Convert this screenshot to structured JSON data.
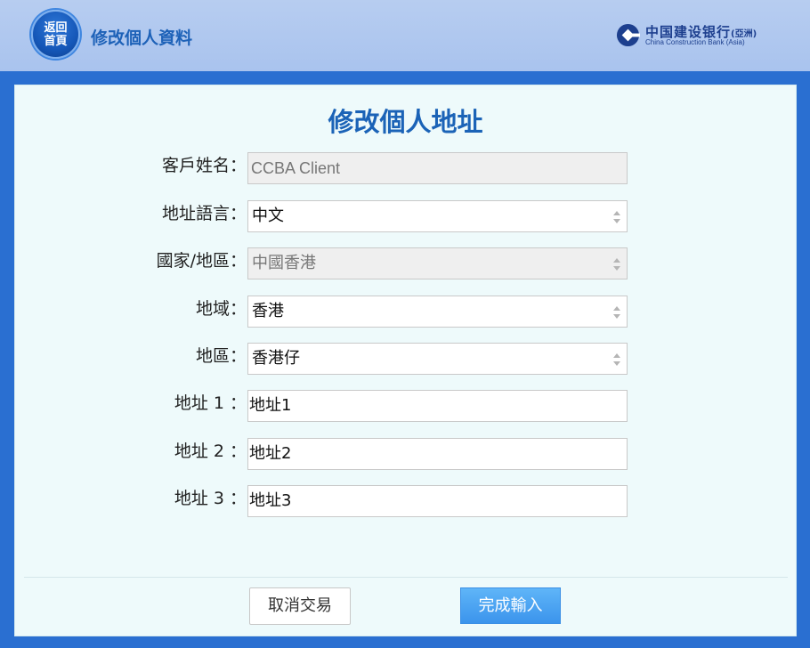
{
  "header": {
    "home_label": "返回首頁",
    "title": "修改個人資料",
    "logo_cn": "中国建设银行",
    "logo_cn_suffix": "(亞洲)",
    "logo_en": "China Construction Bank (Asia)"
  },
  "form": {
    "title": "修改個人地址",
    "fields": [
      {
        "label": "客戶姓名：",
        "value": "CCBA Client",
        "type": "readonly"
      },
      {
        "label": "地址語言：",
        "value": "中文",
        "type": "select"
      },
      {
        "label": "國家/地區：",
        "value": "中國香港",
        "type": "select-disabled"
      },
      {
        "label": "地域：",
        "value": "香港",
        "type": "select"
      },
      {
        "label": "地區：",
        "value": "香港仔",
        "type": "select"
      },
      {
        "label": "地址 1 ：",
        "value": "地址1",
        "type": "input"
      },
      {
        "label": "地址 2 ：",
        "value": "地址2",
        "type": "input"
      },
      {
        "label": "地址 3 ：",
        "value": "地址3",
        "type": "input"
      }
    ]
  },
  "actions": {
    "cancel_label": "取消交易",
    "confirm_label": "完成輸入"
  },
  "colors": {
    "brand_blue": "#1b63b7",
    "page_background": "#2a6fd1",
    "panel_background": "#eefafb",
    "confirm_button": "#4aa3f2"
  }
}
